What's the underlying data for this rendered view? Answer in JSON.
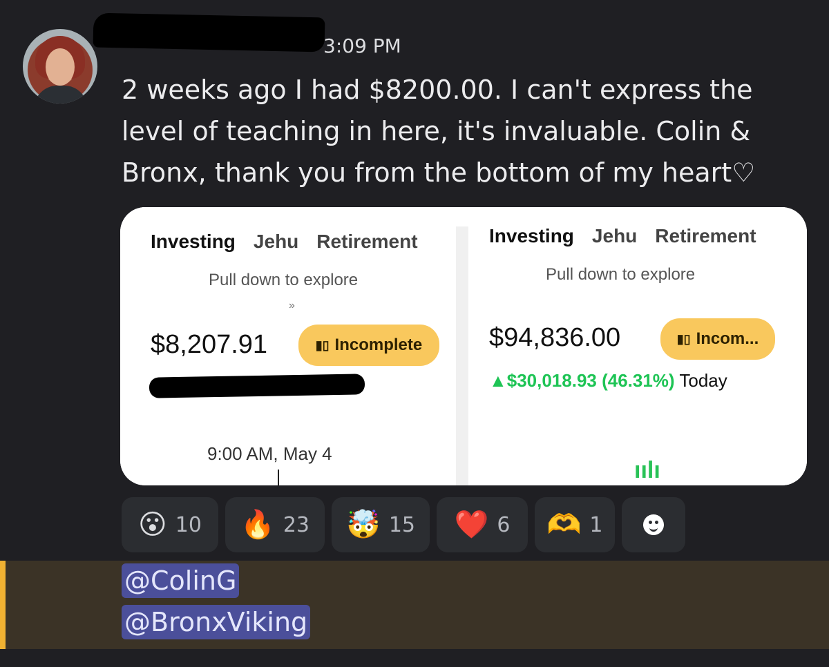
{
  "message": {
    "timestamp": "3:09 PM",
    "text": "2 weeks ago I had $8200.00.  I can't express the\nlevel of teaching in here, it's invaluable.   Colin &\nBronx, thank you from the bottom of my heart♡"
  },
  "screenshots": {
    "left": {
      "tabs": [
        "Investing",
        "Jehu",
        "Retirement"
      ],
      "pull_hint": "Pull down to explore",
      "chevron": "»",
      "amount": "$8,207.91",
      "badge": "Incomplete",
      "timestamp": "9:00 AM, May 4"
    },
    "right": {
      "tabs": [
        "Investing",
        "Jehu",
        "Retirement"
      ],
      "pull_hint": "Pull down to explore",
      "amount": "$94,836.00",
      "badge": "Incom...",
      "gain": "▲$30,018.93 (46.31%)",
      "gain_period": "Today",
      "accent": "#1ec455"
    },
    "badge_color": "#f9c85d"
  },
  "reactions": [
    {
      "icon": "astonished-face-icon",
      "emoji": "😮",
      "count": "10"
    },
    {
      "icon": "fire-icon",
      "emoji": "🔥",
      "count": "23"
    },
    {
      "icon": "exploding-head-icon",
      "emoji": "🤯",
      "count": "15"
    },
    {
      "icon": "red-heart-icon",
      "emoji": "❤️",
      "count": "6"
    },
    {
      "icon": "heart-hands-icon",
      "emoji": "🫶",
      "count": "1"
    }
  ],
  "mentions": [
    "@ColinG",
    "@BronxViking"
  ],
  "colors": {
    "background": "#1f1f23",
    "mention_highlight": "#3b3326",
    "mention_edge": "#f0b232",
    "mention_pill": "#4b4f9a"
  }
}
